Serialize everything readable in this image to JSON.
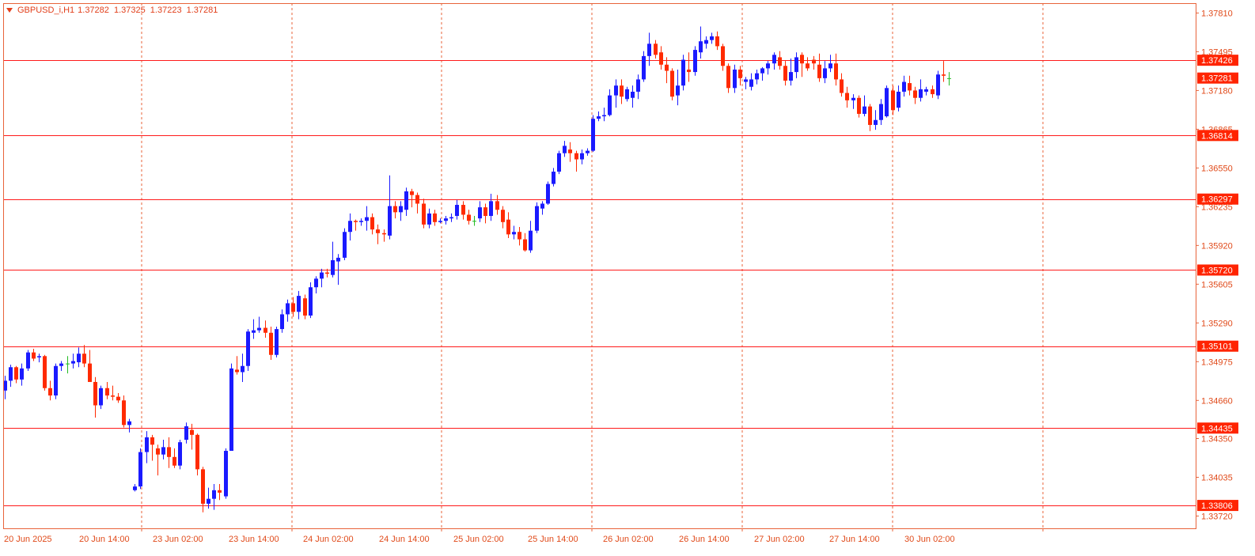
{
  "header": {
    "symbol": "GBPUSD_i,H1",
    "open": "1.37282",
    "high": "1.37325",
    "low": "1.37223",
    "close": "1.37281"
  },
  "colors": {
    "background": "#ffffff",
    "frame": "#e8633a",
    "grid": "#e8633a",
    "level_line": "#ff1a1a",
    "bull": "#1a1aff",
    "bear": "#ff2a00",
    "doji": "#22bb22",
    "label_bg": "#ff2400",
    "label_text": "#ffffff",
    "axis_text": "#e04a1a"
  },
  "chart_data": {
    "type": "candlestick",
    "ylim": [
      1.3362,
      1.3789
    ],
    "price_ticks": [
      "1.37810",
      "1.37495",
      "1.37180",
      "1.36865",
      "1.36550",
      "1.36235",
      "1.35920",
      "1.35605",
      "1.35290",
      "1.34975",
      "1.34660",
      "1.34350",
      "1.34035",
      "1.33720"
    ],
    "time_labels": [
      "20 Jun 2025",
      "20 Jun 14:00",
      "23 Jun 02:00",
      "23 Jun 14:00",
      "24 Jun 02:00",
      "24 Jun 14:00",
      "25 Jun 02:00",
      "25 Jun 14:00",
      "26 Jun 02:00",
      "26 Jun 14:00",
      "27 Jun 02:00",
      "27 Jun 14:00",
      "30 Jun 02:00"
    ],
    "horizontal_levels": [
      "1.37426",
      "1.36814",
      "1.36297",
      "1.35720",
      "1.35101",
      "1.34435",
      "1.33806"
    ],
    "current_price": "1.37281",
    "candles": [
      [
        1.3474,
        1.3486,
        1.3467,
        1.3482
      ],
      [
        1.3482,
        1.3495,
        1.3477,
        1.3493
      ],
      [
        1.3493,
        1.3494,
        1.348,
        1.3483
      ],
      [
        1.3483,
        1.3496,
        1.3478,
        1.3492
      ],
      [
        1.3492,
        1.3507,
        1.349,
        1.3505
      ],
      [
        1.3505,
        1.3508,
        1.3498,
        1.35
      ],
      [
        1.3501,
        1.3504,
        1.3497,
        1.3502
      ],
      [
        1.3502,
        1.3503,
        1.3474,
        1.3476
      ],
      [
        1.3476,
        1.3482,
        1.3466,
        1.347
      ],
      [
        1.347,
        1.3496,
        1.3467,
        1.3494
      ],
      [
        1.3494,
        1.3498,
        1.349,
        1.3496
      ],
      [
        1.3496,
        1.3502,
        1.3488,
        1.3496
      ],
      [
        1.3496,
        1.3504,
        1.3492,
        1.3498
      ],
      [
        1.3497,
        1.3509,
        1.3493,
        1.3504
      ],
      [
        1.3504,
        1.3511,
        1.3493,
        1.3496
      ],
      [
        1.3496,
        1.3507,
        1.3487,
        1.3481
      ],
      [
        1.3481,
        1.3485,
        1.3452,
        1.3462
      ],
      [
        1.3462,
        1.3478,
        1.3459,
        1.3476
      ],
      [
        1.3476,
        1.3481,
        1.3467,
        1.347
      ],
      [
        1.347,
        1.3478,
        1.3466,
        1.3469
      ],
      [
        1.3469,
        1.3472,
        1.3464,
        1.3466
      ],
      [
        1.3466,
        1.347,
        1.3444,
        1.3446
      ],
      [
        1.3446,
        1.3451,
        1.344,
        1.3449
      ],
      [
        1.3393,
        1.3398,
        1.3392,
        1.3396
      ],
      [
        1.3396,
        1.3427,
        1.3394,
        1.3424
      ],
      [
        1.3424,
        1.3441,
        1.3415,
        1.3436
      ],
      [
        1.3436,
        1.3438,
        1.3417,
        1.343
      ],
      [
        1.3427,
        1.343,
        1.3405,
        1.3422
      ],
      [
        1.3422,
        1.3434,
        1.3418,
        1.3428
      ],
      [
        1.3428,
        1.3436,
        1.3411,
        1.342
      ],
      [
        1.342,
        1.3427,
        1.3411,
        1.3413
      ],
      [
        1.3413,
        1.3434,
        1.341,
        1.3432
      ],
      [
        1.3434,
        1.3448,
        1.3431,
        1.3445
      ],
      [
        1.3442,
        1.3447,
        1.3426,
        1.3438
      ],
      [
        1.3438,
        1.3439,
        1.3405,
        1.341
      ],
      [
        1.341,
        1.3412,
        1.3375,
        1.3382
      ],
      [
        1.3382,
        1.3395,
        1.3378,
        1.3386
      ],
      [
        1.3386,
        1.3398,
        1.3377,
        1.3393
      ],
      [
        1.3393,
        1.3398,
        1.3385,
        1.3391
      ],
      [
        1.3388,
        1.3427,
        1.3386,
        1.3425
      ],
      [
        1.3425,
        1.3496,
        1.3425,
        1.3492
      ],
      [
        1.3491,
        1.3502,
        1.3487,
        1.3489
      ],
      [
        1.3489,
        1.3504,
        1.3481,
        1.3494
      ],
      [
        1.3494,
        1.3524,
        1.349,
        1.3522
      ],
      [
        1.3521,
        1.3532,
        1.3516,
        1.3523
      ],
      [
        1.3523,
        1.3534,
        1.3521,
        1.3525
      ],
      [
        1.3525,
        1.3531,
        1.3517,
        1.3521
      ],
      [
        1.3521,
        1.3526,
        1.3499,
        1.3503
      ],
      [
        1.3503,
        1.3526,
        1.3501,
        1.3524
      ],
      [
        1.3524,
        1.354,
        1.3521,
        1.3536
      ],
      [
        1.3536,
        1.3548,
        1.353,
        1.3545
      ],
      [
        1.3545,
        1.355,
        1.3534,
        1.3538
      ],
      [
        1.3538,
        1.3555,
        1.3532,
        1.3551
      ],
      [
        1.3549,
        1.3552,
        1.3532,
        1.3535
      ],
      [
        1.3535,
        1.3562,
        1.3533,
        1.3558
      ],
      [
        1.3558,
        1.3567,
        1.3553,
        1.3565
      ],
      [
        1.3565,
        1.3573,
        1.3558,
        1.357
      ],
      [
        1.357,
        1.3573,
        1.3566,
        1.3569
      ],
      [
        1.3568,
        1.3595,
        1.3566,
        1.358
      ],
      [
        1.3579,
        1.3585,
        1.356,
        1.3582
      ],
      [
        1.3582,
        1.3606,
        1.358,
        1.3603
      ],
      [
        1.3603,
        1.3618,
        1.3596,
        1.3612
      ],
      [
        1.3612,
        1.3613,
        1.3604,
        1.3611
      ],
      [
        1.3611,
        1.3614,
        1.3608,
        1.3612
      ],
      [
        1.3612,
        1.3624,
        1.3604,
        1.3615
      ],
      [
        1.3615,
        1.3618,
        1.3601,
        1.3605
      ],
      [
        1.3605,
        1.3609,
        1.3593,
        1.3602
      ],
      [
        1.3602,
        1.3605,
        1.3595,
        1.3601
      ],
      [
        1.36,
        1.3649,
        1.3597,
        1.3624
      ],
      [
        1.3624,
        1.3628,
        1.3614,
        1.3619
      ],
      [
        1.3619,
        1.3628,
        1.3612,
        1.3624
      ],
      [
        1.3621,
        1.3639,
        1.3616,
        1.3636
      ],
      [
        1.3636,
        1.3638,
        1.3623,
        1.3633
      ],
      [
        1.3633,
        1.3635,
        1.3618,
        1.3626
      ],
      [
        1.3626,
        1.363,
        1.3606,
        1.3609
      ],
      [
        1.3609,
        1.3622,
        1.3606,
        1.3618
      ],
      [
        1.3618,
        1.3621,
        1.3608,
        1.3611
      ],
      [
        1.3611,
        1.3614,
        1.361,
        1.3612
      ],
      [
        1.3612,
        1.3616,
        1.3609,
        1.3614
      ],
      [
        1.3614,
        1.3618,
        1.3611,
        1.3615
      ],
      [
        1.3616,
        1.3629,
        1.3613,
        1.3625
      ],
      [
        1.3625,
        1.3628,
        1.3613,
        1.3617
      ],
      [
        1.3617,
        1.3621,
        1.3609,
        1.3612
      ],
      [
        1.3612,
        1.3616,
        1.3608,
        1.3612
      ],
      [
        1.3614,
        1.3628,
        1.3611,
        1.3623
      ],
      [
        1.3623,
        1.3626,
        1.361,
        1.3616
      ],
      [
        1.3616,
        1.3634,
        1.3612,
        1.3628
      ],
      [
        1.3628,
        1.3633,
        1.3617,
        1.3621
      ],
      [
        1.3621,
        1.3624,
        1.3606,
        1.3611
      ],
      [
        1.3613,
        1.3619,
        1.3598,
        1.3601
      ],
      [
        1.3601,
        1.3608,
        1.3597,
        1.3603
      ],
      [
        1.3603,
        1.3607,
        1.3592,
        1.3597
      ],
      [
        1.3597,
        1.3602,
        1.3587,
        1.3588
      ],
      [
        1.3588,
        1.3612,
        1.3586,
        1.3604
      ],
      [
        1.3604,
        1.3627,
        1.3602,
        1.3624
      ],
      [
        1.3622,
        1.3628,
        1.3617,
        1.3626
      ],
      [
        1.3626,
        1.3644,
        1.3625,
        1.3642
      ],
      [
        1.3642,
        1.3655,
        1.364,
        1.3652
      ],
      [
        1.3652,
        1.3669,
        1.365,
        1.3667
      ],
      [
        1.3667,
        1.3677,
        1.3664,
        1.3673
      ],
      [
        1.367,
        1.3676,
        1.366,
        1.3667
      ],
      [
        1.3667,
        1.3669,
        1.3652,
        1.3662
      ],
      [
        1.3662,
        1.367,
        1.3658,
        1.3667
      ],
      [
        1.3667,
        1.3671,
        1.3665,
        1.3669
      ],
      [
        1.3669,
        1.3698,
        1.3668,
        1.3695
      ],
      [
        1.3695,
        1.3701,
        1.3693,
        1.3697
      ],
      [
        1.3697,
        1.3704,
        1.3693,
        1.3698
      ],
      [
        1.3698,
        1.3719,
        1.3697,
        1.3714
      ],
      [
        1.3714,
        1.3727,
        1.3704,
        1.3722
      ],
      [
        1.3722,
        1.3727,
        1.3707,
        1.3713
      ],
      [
        1.3711,
        1.3721,
        1.3709,
        1.3719
      ],
      [
        1.3712,
        1.3722,
        1.3704,
        1.3717
      ],
      [
        1.3717,
        1.3731,
        1.3711,
        1.3727
      ],
      [
        1.3727,
        1.375,
        1.3725,
        1.3746
      ],
      [
        1.3746,
        1.3765,
        1.3738,
        1.3756
      ],
      [
        1.3756,
        1.3759,
        1.3744,
        1.3747
      ],
      [
        1.3749,
        1.3754,
        1.3735,
        1.3739
      ],
      [
        1.3739,
        1.3745,
        1.3724,
        1.3734
      ],
      [
        1.3734,
        1.3736,
        1.371,
        1.3713
      ],
      [
        1.3714,
        1.3735,
        1.3706,
        1.3722
      ],
      [
        1.3722,
        1.3747,
        1.3718,
        1.3743
      ],
      [
        1.3735,
        1.3749,
        1.3725,
        1.3733
      ],
      [
        1.3733,
        1.3754,
        1.373,
        1.3751
      ],
      [
        1.3749,
        1.377,
        1.3744,
        1.3758
      ],
      [
        1.3756,
        1.3762,
        1.3752,
        1.3759
      ],
      [
        1.3759,
        1.3765,
        1.3756,
        1.3762
      ],
      [
        1.3762,
        1.3766,
        1.3751,
        1.3754
      ],
      [
        1.3754,
        1.3756,
        1.3734,
        1.3738
      ],
      [
        1.3738,
        1.374,
        1.3716,
        1.372
      ],
      [
        1.372,
        1.3739,
        1.3716,
        1.3735
      ],
      [
        1.3735,
        1.3738,
        1.3722,
        1.3728
      ],
      [
        1.3725,
        1.3729,
        1.3719,
        1.3727
      ],
      [
        1.3721,
        1.3732,
        1.3718,
        1.3727
      ],
      [
        1.3727,
        1.3735,
        1.3723,
        1.3732
      ],
      [
        1.3732,
        1.3737,
        1.3726,
        1.3736
      ],
      [
        1.3736,
        1.3742,
        1.3731,
        1.374
      ],
      [
        1.374,
        1.3749,
        1.3735,
        1.3747
      ],
      [
        1.3745,
        1.375,
        1.3735,
        1.3738
      ],
      [
        1.3738,
        1.3742,
        1.3722,
        1.3726
      ],
      [
        1.3726,
        1.3744,
        1.3722,
        1.3733
      ],
      [
        1.3733,
        1.3749,
        1.3728,
        1.3745
      ],
      [
        1.3747,
        1.3749,
        1.3729,
        1.374
      ],
      [
        1.374,
        1.3745,
        1.3734,
        1.3736
      ],
      [
        1.3743,
        1.3746,
        1.3735,
        1.374
      ],
      [
        1.3739,
        1.3748,
        1.3725,
        1.3728
      ],
      [
        1.3728,
        1.3742,
        1.3724,
        1.3736
      ],
      [
        1.3736,
        1.3747,
        1.3733,
        1.374
      ],
      [
        1.374,
        1.3748,
        1.3722,
        1.3727
      ],
      [
        1.3727,
        1.3732,
        1.3713,
        1.3716
      ],
      [
        1.3716,
        1.3721,
        1.3704,
        1.371
      ],
      [
        1.371,
        1.3715,
        1.3703,
        1.3712
      ],
      [
        1.3712,
        1.3714,
        1.3696,
        1.3699
      ],
      [
        1.3699,
        1.3714,
        1.3697,
        1.3705
      ],
      [
        1.3705,
        1.3707,
        1.3685,
        1.369
      ],
      [
        1.369,
        1.3702,
        1.3686,
        1.3694
      ],
      [
        1.3694,
        1.3711,
        1.369,
        1.3707
      ],
      [
        1.3697,
        1.3722,
        1.3696,
        1.372
      ],
      [
        1.3718,
        1.3722,
        1.3698,
        1.3702
      ],
      [
        1.3704,
        1.3722,
        1.3701,
        1.3717
      ],
      [
        1.3717,
        1.373,
        1.3713,
        1.3725
      ],
      [
        1.3724,
        1.373,
        1.3714,
        1.3718
      ],
      [
        1.3718,
        1.3721,
        1.3707,
        1.3712
      ],
      [
        1.3712,
        1.3727,
        1.3709,
        1.3719
      ],
      [
        1.3717,
        1.3721,
        1.3714,
        1.3719
      ],
      [
        1.3719,
        1.3722,
        1.3712,
        1.3715
      ],
      [
        1.3714,
        1.3734,
        1.3711,
        1.3731
      ],
      [
        1.3731,
        1.3742,
        1.3725,
        1.373
      ],
      [
        1.3728,
        1.3733,
        1.3722,
        1.3728
      ]
    ]
  }
}
